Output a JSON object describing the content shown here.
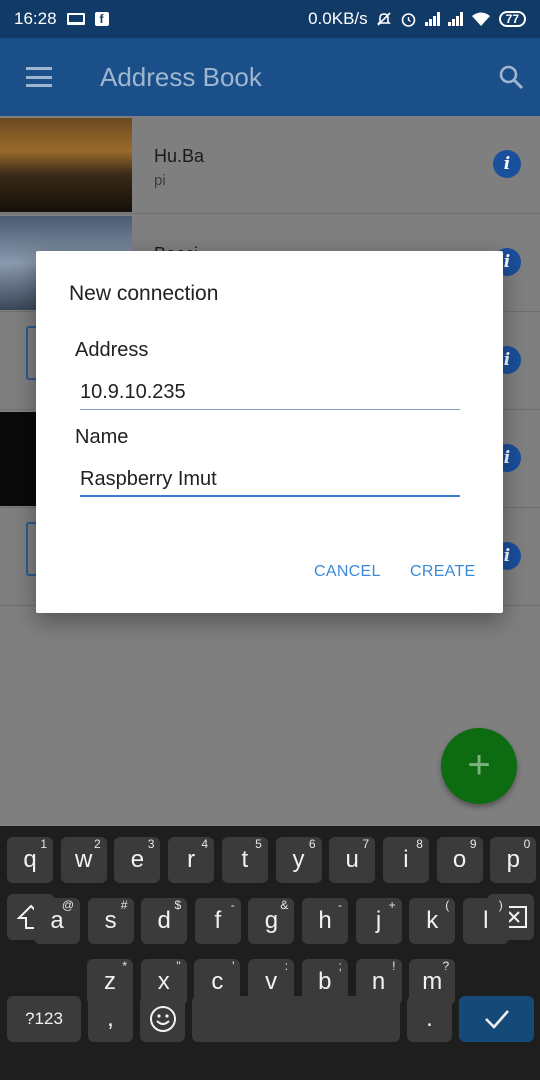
{
  "status_bar": {
    "time": "16:28",
    "network_speed": "0.0KB/s",
    "battery": "77",
    "icons": [
      "laptop-icon",
      "facebook-icon",
      "mute-icon",
      "alarm-icon",
      "signal-icon",
      "signal-icon",
      "wifi-icon",
      "battery-icon"
    ]
  },
  "app_bar": {
    "title": "Address Book",
    "menu_icon": "menu-icon",
    "search_icon": "search-icon"
  },
  "list": [
    {
      "title": "Hu.Ba",
      "subtitle": "pi"
    },
    {
      "title": "Bacci",
      "subtitle": ""
    },
    {
      "title": "",
      "subtitle": ""
    },
    {
      "title": "",
      "subtitle": ""
    },
    {
      "title": "",
      "subtitle": ""
    }
  ],
  "fab": {
    "label": "+"
  },
  "dialog": {
    "title": "New connection",
    "address_label": "Address",
    "address_value": "10.9.10.235",
    "name_label": "Name",
    "name_value": "Raspberry Imut",
    "cancel_label": "CANCEL",
    "create_label": "CREATE"
  },
  "keyboard": {
    "row1": [
      {
        "k": "q",
        "s": "1"
      },
      {
        "k": "w",
        "s": "2"
      },
      {
        "k": "e",
        "s": "3"
      },
      {
        "k": "r",
        "s": "4"
      },
      {
        "k": "t",
        "s": "5"
      },
      {
        "k": "y",
        "s": "6"
      },
      {
        "k": "u",
        "s": "7"
      },
      {
        "k": "i",
        "s": "8"
      },
      {
        "k": "o",
        "s": "9"
      },
      {
        "k": "p",
        "s": "0"
      }
    ],
    "row2": [
      {
        "k": "a",
        "s": "@"
      },
      {
        "k": "s",
        "s": "#"
      },
      {
        "k": "d",
        "s": "$"
      },
      {
        "k": "f",
        "s": "-"
      },
      {
        "k": "g",
        "s": "&"
      },
      {
        "k": "h",
        "s": "-"
      },
      {
        "k": "j",
        "s": "+"
      },
      {
        "k": "k",
        "s": "("
      },
      {
        "k": "l",
        "s": ")"
      }
    ],
    "row3": [
      {
        "k": "z",
        "s": "*"
      },
      {
        "k": "x",
        "s": "\""
      },
      {
        "k": "c",
        "s": "'"
      },
      {
        "k": "v",
        "s": ":"
      },
      {
        "k": "b",
        "s": ";"
      },
      {
        "k": "n",
        "s": "!"
      },
      {
        "k": "m",
        "s": "?"
      }
    ],
    "symbols_label": "?123",
    "comma": ",",
    "period": "."
  },
  "colors": {
    "app_bar": "#1b4f8a",
    "status_bar": "#123a66",
    "accent": "#3a8ad8",
    "fab": "#0d6b12",
    "info": "#1a4f9c"
  }
}
